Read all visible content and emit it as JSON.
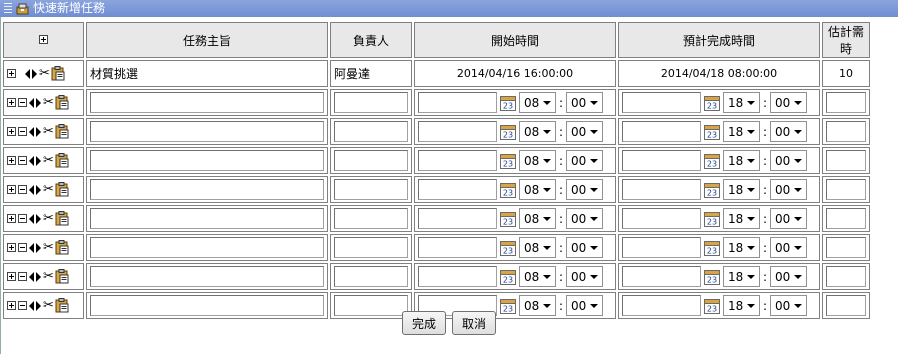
{
  "window": {
    "title": "快速新增任務"
  },
  "table": {
    "headers": {
      "control": "",
      "subject": "任務主旨",
      "owner": "負責人",
      "start": "開始時間",
      "due": "預計完成時間",
      "estimate": "估計需時"
    },
    "first_row": {
      "subject": "材質挑選",
      "owner": "阿曼達",
      "start": "2014/04/16 16:00:00",
      "due": "2014/04/18 08:00:00",
      "estimate": "10"
    },
    "blank_row_defaults": {
      "start_hour": "08",
      "start_minute": "00",
      "due_hour": "18",
      "due_minute": "00",
      "separator": ":"
    },
    "blank_row_count": 8
  },
  "buttons": {
    "done": "完成",
    "cancel": "取消"
  },
  "colors": {
    "titlebar": "#7b97d8",
    "header_bg": "#e8e8e8",
    "grid_border": "#808080"
  },
  "icons": [
    "expand-icon",
    "collapse-icon",
    "move-left-icon",
    "move-right-icon",
    "cut-icon",
    "paste-icon",
    "calendar-icon",
    "dropdown-arrow-icon"
  ]
}
